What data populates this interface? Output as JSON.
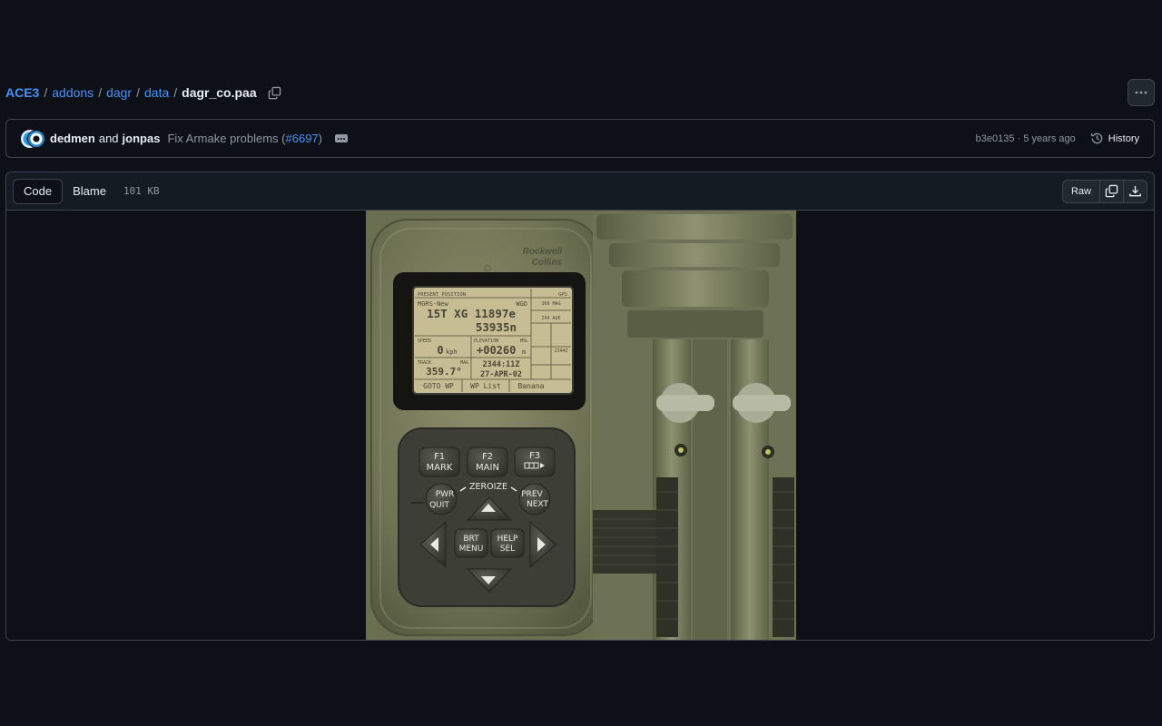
{
  "breadcrumb": {
    "root": "ACE3",
    "parts": [
      "addons",
      "dagr",
      "data"
    ],
    "current": "dagr_co.paa",
    "separator": "/"
  },
  "commit": {
    "author1": "dedmen",
    "and": "and",
    "author2": "jonpas",
    "message": "Fix Armake problems (",
    "pr": "#6697",
    "message_end": ")",
    "sha": "b3e0135",
    "dot": " · ",
    "time": "5 years ago",
    "history_label": "History"
  },
  "file": {
    "tabs": [
      "Code",
      "Blame"
    ],
    "size": "101 KB",
    "raw_label": "Raw"
  },
  "device": {
    "brand_line1": "Rockwell",
    "brand_line2": "Collins",
    "screen": {
      "header_left": "PRESENT POSITION",
      "header_right": "GPS",
      "grid_label": "MGRS-New",
      "datum": "WGD",
      "coord_line1": "15T XG 11897e",
      "coord_line2": "53935n",
      "speed_label": "SPEED",
      "speed_value": "0",
      "speed_unit": "kph",
      "elev_label": "ELEVATION",
      "elev_ref": "MSL",
      "elev_value": "+00260",
      "elev_unit": "m",
      "track_label": "TRACK",
      "track_ref": "MAG",
      "track_value": "359.7°",
      "time_value": "2344:11Z",
      "date_value": "27-APR-02",
      "soft1": "GOTO WP",
      "soft2": "WP List",
      "soft3": "Banana",
      "side1": "360 MAG",
      "side2": "294 AGE",
      "side3": "2344Z"
    },
    "keys": {
      "f1_top": "F1",
      "f1_bottom": "MARK",
      "f2_top": "F2",
      "f2_bottom": "MAIN",
      "f3_top": "F3",
      "zeroize": "ZEROIZE",
      "pwr_top": "PWR",
      "pwr_bottom": "QUIT",
      "prev_top": "PREV",
      "prev_bottom": "NEXT",
      "brt_top": "BRT",
      "brt_bottom": "MENU",
      "help_top": "HELP",
      "help_bottom": "SEL"
    }
  },
  "colors": {
    "accent": "#4493f8",
    "bg": "#0d1117",
    "border": "#3d444d",
    "device_body": "#7a7e5e",
    "screen": "#cfc49a"
  }
}
